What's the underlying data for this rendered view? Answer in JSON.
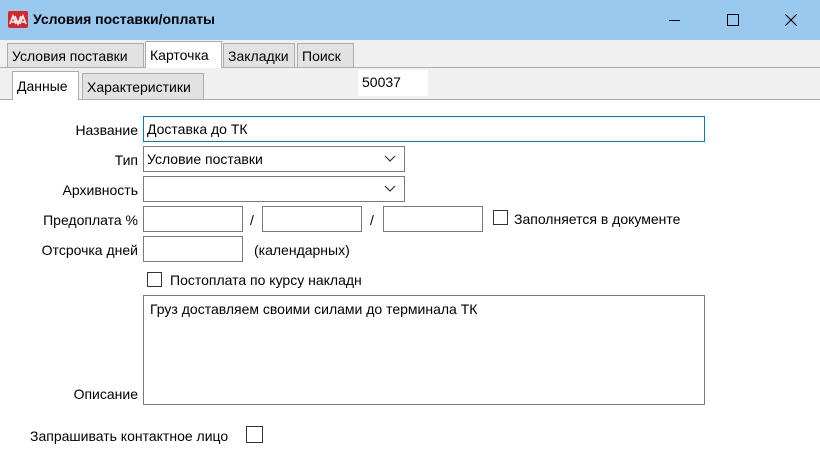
{
  "window": {
    "title": "Условия поставки/оплаты",
    "icon": "app-logo-icon",
    "accent": "#99c9ef"
  },
  "tabs": [
    {
      "label": "Условия поставки",
      "active": false
    },
    {
      "label": "Карточка",
      "active": true
    },
    {
      "label": "Закладки",
      "active": false
    },
    {
      "label": "Поиск",
      "active": false
    }
  ],
  "subtabs": [
    {
      "label": "Данные",
      "active": true
    },
    {
      "label": "Характеристики",
      "active": false
    }
  ],
  "record_id": "50037",
  "form": {
    "name_label": "Название",
    "name_value": "Доставка до ТК",
    "type_label": "Тип",
    "type_value": "Условие поставки",
    "archive_label": "Архивность",
    "archive_value": "",
    "prepay_label": "Предоплата %",
    "prepay_values": [
      "",
      "",
      ""
    ],
    "slash": "/",
    "filled_in_doc_label": "Заполняется в документе",
    "filled_in_doc_checked": false,
    "delay_label": "Отсрочка дней",
    "delay_value": "",
    "delay_unit": "(календарных)",
    "postpay_label": "Постоплата по курсу накладн",
    "postpay_checked": false,
    "description_label": "Описание",
    "description_value": "Груз доставляем своими силами до терминала ТК",
    "contact_label": "Запрашивать контактное лицо",
    "contact_checked": false
  }
}
